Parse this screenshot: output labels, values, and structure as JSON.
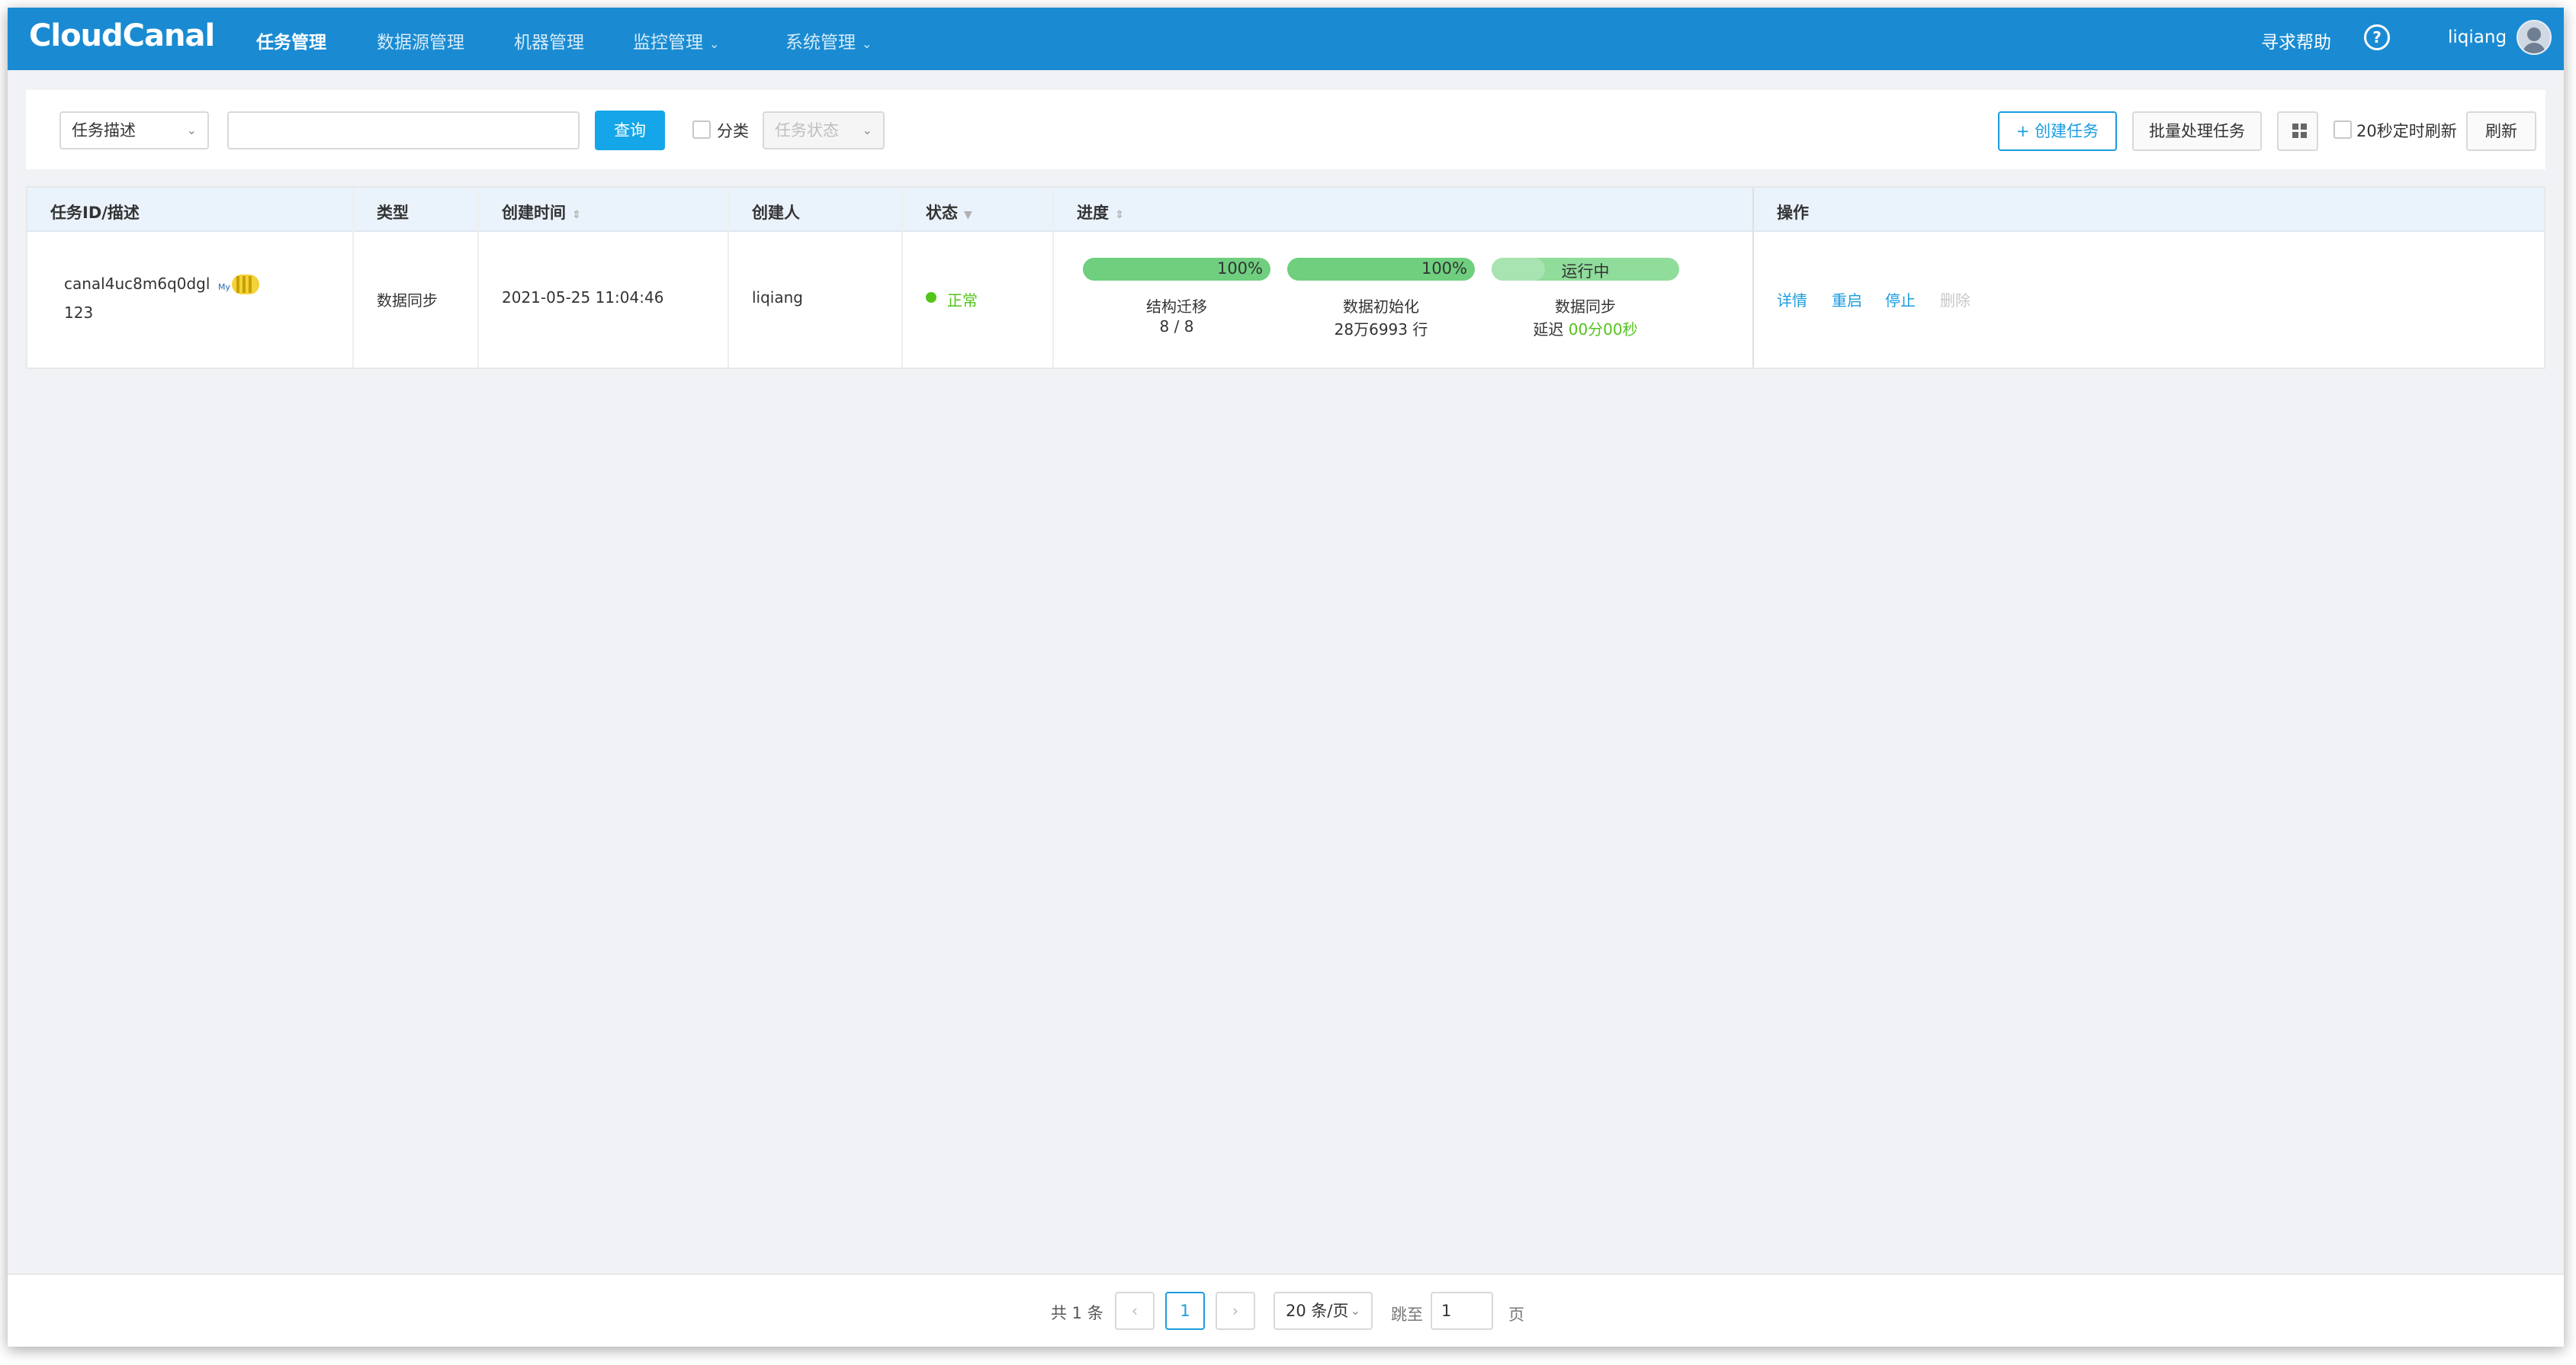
{
  "nav": {
    "logo": "CloudCanal",
    "items": [
      {
        "label": "任务管理",
        "active": true,
        "dropdown": false
      },
      {
        "label": "数据源管理",
        "active": false,
        "dropdown": false
      },
      {
        "label": "机器管理",
        "active": false,
        "dropdown": false
      },
      {
        "label": "监控管理",
        "active": false,
        "dropdown": true
      },
      {
        "label": "系统管理",
        "active": false,
        "dropdown": true
      }
    ],
    "help": "寻求帮助",
    "help_icon": "?",
    "username": "liqiang"
  },
  "toolbar": {
    "filter_select": "任务描述",
    "search_value": "",
    "query_button": "查询",
    "category_label": "分类",
    "status_select_placeholder": "任务状态",
    "create_button": "+ 创建任务",
    "batch_button": "批量处理任务",
    "auto_refresh_label": "20秒定时刷新",
    "refresh_button": "刷新"
  },
  "table": {
    "headers": {
      "id": "任务ID/描述",
      "type": "类型",
      "created": "创建时间",
      "creator": "创建人",
      "status": "状态",
      "progress": "进度",
      "actions": "操作"
    },
    "rows": [
      {
        "task_id": "canal4uc8m6q0dgl",
        "description": "123",
        "type": "数据同步",
        "created_at": "2021-05-25 11:04:46",
        "creator": "liqiang",
        "status": "正常",
        "progress": {
          "schema": {
            "bar": "100%",
            "fraction": 1.0,
            "label": "结构迁移",
            "sub": "8 / 8"
          },
          "init": {
            "bar": "100%",
            "fraction": 1.0,
            "label": "数据初始化",
            "sub": "28万6993 行"
          },
          "sync": {
            "bar": "运行中",
            "label": "数据同步",
            "sub_prefix": "延迟 ",
            "delay": "00分00秒"
          }
        },
        "actions": {
          "detail": "详情",
          "restart": "重启",
          "stop": "停止",
          "delete": "删除"
        }
      }
    ]
  },
  "pagination": {
    "total": "共 1 条",
    "prev": "‹",
    "current_page": "1",
    "next": "›",
    "page_size": "20 条/页",
    "jump_label": "跳至",
    "jump_value": "1",
    "page_suffix": "页"
  },
  "colors": {
    "header_bg": "#1a8bd2",
    "primary": "#14a6e8",
    "link": "#1a9ce0",
    "success": "#52c41a",
    "progress": "#6fcf7f"
  }
}
